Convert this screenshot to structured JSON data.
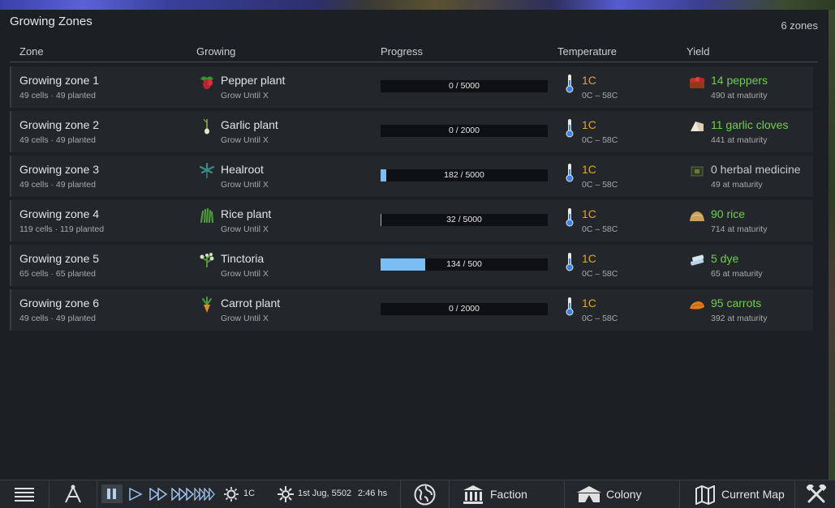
{
  "window": {
    "title": "Growing Zones",
    "zone_count": "6 zones"
  },
  "columns": {
    "zone": "Zone",
    "growing": "Growing",
    "progress": "Progress",
    "temperature": "Temperature",
    "yield": "Yield"
  },
  "zones": [
    {
      "name": "Growing zone 1",
      "cells": "49 cells · 49 planted",
      "plant": "Pepper plant",
      "plant_icon": "pepper-plant-icon",
      "mode": "Grow Until X",
      "progress_text": "0 / 5000",
      "progress_fraction": 0,
      "temp": "1C",
      "temp_range": "0C – 58C",
      "yield": "14 peppers",
      "yield_color": "#6fcf4a",
      "yield_icon": "peppers-icon",
      "maturity": "490 at maturity"
    },
    {
      "name": "Growing zone 2",
      "cells": "49 cells · 49 planted",
      "plant": "Garlic plant",
      "plant_icon": "garlic-plant-icon",
      "mode": "Grow Until X",
      "progress_text": "0 / 2000",
      "progress_fraction": 0,
      "temp": "1C",
      "temp_range": "0C – 58C",
      "yield": "11 garlic cloves",
      "yield_color": "#6fcf4a",
      "yield_icon": "garlic-cloves-icon",
      "maturity": "441 at maturity"
    },
    {
      "name": "Growing zone 3",
      "cells": "49 cells · 49 planted",
      "plant": "Healroot",
      "plant_icon": "healroot-icon",
      "mode": "Grow Until X",
      "progress_text": "182 / 5000",
      "progress_fraction": 0.0364,
      "temp": "1C",
      "temp_range": "0C – 58C",
      "yield": "0 herbal medicine",
      "yield_color": "#c8c8c8",
      "yield_icon": "herbal-medicine-icon",
      "maturity": "49 at maturity"
    },
    {
      "name": "Growing zone 4",
      "cells": "119 cells · 119 planted",
      "plant": "Rice plant",
      "plant_icon": "rice-plant-icon",
      "mode": "Grow Until X",
      "progress_text": "32 / 5000",
      "progress_fraction": 0.0064,
      "temp": "1C",
      "temp_range": "0C – 58C",
      "yield": "90 rice",
      "yield_color": "#6fcf4a",
      "yield_icon": "rice-icon",
      "maturity": "714 at maturity"
    },
    {
      "name": "Growing zone 5",
      "cells": "65 cells · 65 planted",
      "plant": "Tinctoria",
      "plant_icon": "tinctoria-icon",
      "mode": "Grow Until X",
      "progress_text": "134 / 500",
      "progress_fraction": 0.268,
      "temp": "1C",
      "temp_range": "0C – 58C",
      "yield": "5 dye",
      "yield_color": "#6fcf4a",
      "yield_icon": "dye-icon",
      "maturity": "65 at maturity"
    },
    {
      "name": "Growing zone 6",
      "cells": "49 cells · 49 planted",
      "plant": "Carrot plant",
      "plant_icon": "carrot-plant-icon",
      "mode": "Grow Until X",
      "progress_text": "0 / 2000",
      "progress_fraction": 0,
      "temp": "1C",
      "temp_range": "0C – 58C",
      "yield": "95 carrots",
      "yield_color": "#6fcf4a",
      "yield_icon": "carrots-icon",
      "maturity": "392 at maturity"
    }
  ],
  "bottom_bar": {
    "temperature": "1C",
    "date": "1st Jug, 5502",
    "time": "2:46 hs",
    "faction": "Faction",
    "colony": "Colony",
    "current_map": "Current Map"
  }
}
